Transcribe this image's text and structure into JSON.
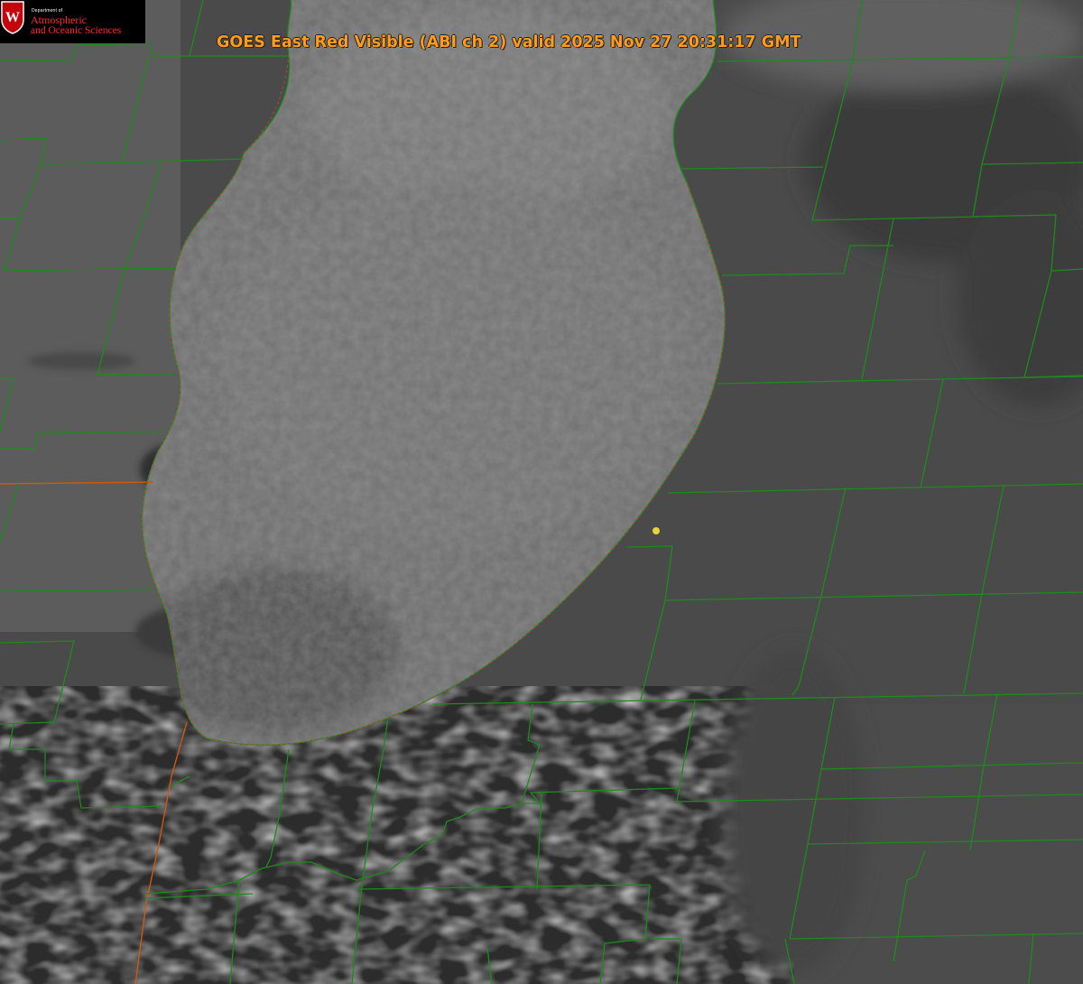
{
  "title": "GOES East Red Visible (ABI ch 2) valid 2025 Nov 27 20:31:17 GMT",
  "logo": {
    "department": "Department of",
    "line1": "Atmospheric",
    "line2": "and Oceanic Sciences",
    "shield_letter": "W"
  },
  "colors": {
    "county_lines": "#1e8a1e",
    "lake_shore_dashes": "#d64040",
    "state_line": "#c85a14",
    "title_text": "#ff9a1a",
    "logo_text": "#ff2a2a",
    "marker": "#e8d43a",
    "logo_background": "#000000"
  },
  "imagery": {
    "type": "satellite-visible",
    "features": [
      "lake",
      "lake-effect-cloud-bands",
      "county-boundaries"
    ]
  }
}
